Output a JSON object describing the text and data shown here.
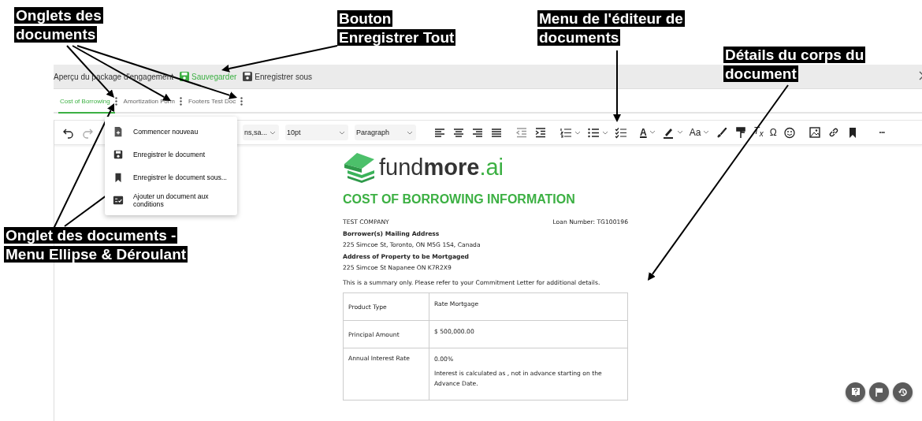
{
  "annotations": [
    {
      "lines": [
        "Onglets des",
        "documents"
      ]
    },
    {
      "lines": [
        "Bouton",
        "Enregistrer Tout"
      ]
    },
    {
      "lines": [
        "Menu de l'éditeur de",
        "documents"
      ]
    },
    {
      "lines": [
        "Détails du corps du",
        "document"
      ]
    },
    {
      "lines": [
        "Onglet des documents -",
        "Menu Ellipse & Déroulant"
      ]
    }
  ],
  "top_bar": {
    "title": "Aperçu du package d'engagement",
    "buttons": [
      {
        "label": "Sauvegarder",
        "kind": "primary"
      },
      {
        "label": "Enregistrer sous",
        "kind": "plain"
      }
    ]
  },
  "tabs": [
    {
      "label": "Cost of Borrowing",
      "selected": true
    },
    {
      "label": "Amortization Form",
      "selected": false
    },
    {
      "label": "Footers Test Doc",
      "selected": false
    }
  ],
  "tab_menu": [
    {
      "label": "Commencer nouveau",
      "kind": "new"
    },
    {
      "label": "Enregistrer le document",
      "kind": "save"
    },
    {
      "label": "Enregistrer le document sous...",
      "kind": "bookmark"
    },
    {
      "label": "Ajouter un document aux conditions",
      "kind": "checklist"
    }
  ],
  "editor_toolbar": {
    "font_family": "ns,sa...",
    "font_size": "10pt",
    "block_format": "Paragraph",
    "text_color_glyph": "A",
    "font_case_glyph": "Aa",
    "clear_format_glyph": "T$_{x}$",
    "special_char_glyph": "Ω",
    "more_glyph": "•••"
  },
  "document": {
    "logo": {
      "prefix": "fund",
      "bold": "more",
      "suffix": ".ai"
    },
    "heading": "COST OF BORROWING INFORMATION",
    "company": "TEST COMPANY",
    "loan_number": "Loan Number: TG100196",
    "lines": [
      {
        "text": "Borrower(s) Mailing Address",
        "kind": "label"
      },
      {
        "text": "225 Simcoe St, Toronto, ON M5G 1S4, Canada",
        "kind": "value"
      },
      {
        "text": "Address of Property to be Mortgaged",
        "kind": "label"
      },
      {
        "text": "225 Simcoe St Napanee ON K7R2X9",
        "kind": "value"
      }
    ],
    "note": "This is a summary only. Please refer to your Commitment Letter for additional details.",
    "table": [
      {
        "label": "Product Type",
        "values": [
          "Rate Mortgage"
        ]
      },
      {
        "label": "Principal Amount",
        "values": [
          "$ 500,000.00"
        ]
      },
      {
        "label": "Annual Interest Rate",
        "values": [
          "0.00%",
          "Interest is calculated as , not in advance starting on the Advance Date."
        ]
      }
    ]
  }
}
